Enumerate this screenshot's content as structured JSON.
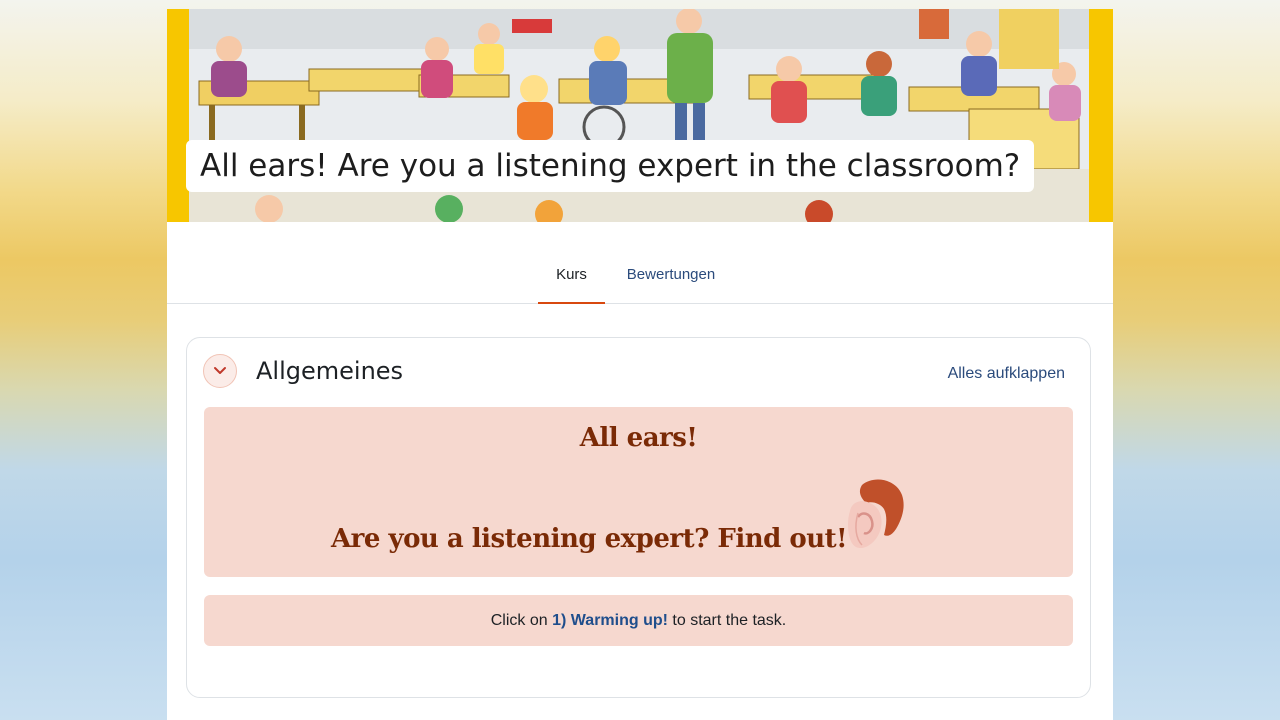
{
  "banner": {
    "title": "All ears! Are you a listening expert in the classroom?"
  },
  "tabs": [
    {
      "label": "Kurs",
      "active": true
    },
    {
      "label": "Bewertungen",
      "active": false
    }
  ],
  "section": {
    "title": "Allgemeines",
    "expand_all": "Alles aufklappen",
    "intro": {
      "heading": "All ears!",
      "subheading": "Are you a listening expert? Find out!"
    },
    "instruction": {
      "prefix": "Click on",
      "link": "1) Warming up!",
      "suffix": "to start the task."
    }
  },
  "colors": {
    "accent": "#d8480f",
    "link": "#2b4b7c",
    "box_bg": "#f6d8cf",
    "heading_text": "#7a2a06",
    "banner_frame": "#f7c600"
  },
  "icons": {
    "collapse": "chevron-down-icon",
    "ear": "ear-image"
  }
}
